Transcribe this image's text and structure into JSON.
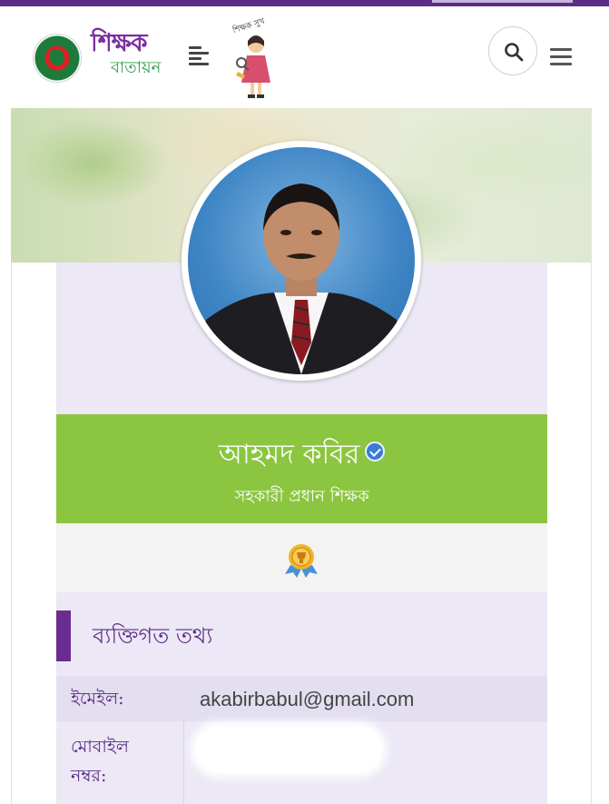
{
  "brand": {
    "title": "শিক্ষক",
    "subtitle": "বাতায়ন",
    "mascot_sign": "শিক্ষক সুখ"
  },
  "icons": {
    "gov_logo": "bangladesh-government-seal",
    "left_menu": "align-left-icon",
    "search": "search-icon",
    "right_menu": "hamburger-icon",
    "verified": "verified-check-icon",
    "award": "award-medal-icon"
  },
  "colors": {
    "primary_purple": "#5b2d86",
    "accent_green": "#8cc540",
    "verified_blue": "#3a7bd5",
    "card_bg": "#ece8f5"
  },
  "profile": {
    "name": "আহমদ কবির",
    "role": "সহকারী প্রধান শিক্ষক"
  },
  "section": {
    "title": "ব্যক্তিগত তথ্য"
  },
  "info": {
    "email_label": "ইমেইল:",
    "email_value": "akabirbabul@gmail.com",
    "mobile_label_line1": "মোবাইল",
    "mobile_label_line2": "নম্বর:"
  }
}
